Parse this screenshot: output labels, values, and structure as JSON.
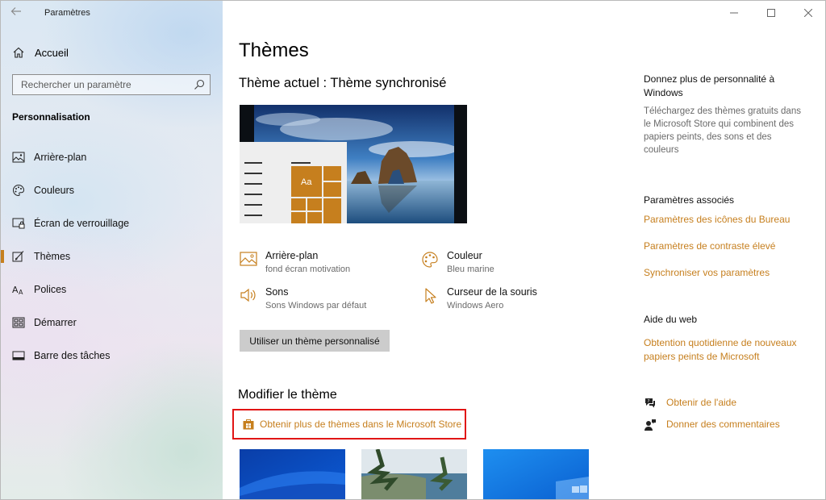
{
  "app": {
    "title": "Paramètres"
  },
  "sidebar": {
    "home_label": "Accueil",
    "search_placeholder": "Rechercher un paramètre",
    "section_title": "Personnalisation",
    "items": [
      {
        "label": "Arrière-plan",
        "icon": "picture-icon"
      },
      {
        "label": "Couleurs",
        "icon": "palette-icon"
      },
      {
        "label": "Écran de verrouillage",
        "icon": "lock-screen-icon"
      },
      {
        "label": "Thèmes",
        "icon": "brush-icon",
        "active": true
      },
      {
        "label": "Polices",
        "icon": "font-icon"
      },
      {
        "label": "Démarrer",
        "icon": "start-icon"
      },
      {
        "label": "Barre des tâches",
        "icon": "taskbar-icon"
      }
    ]
  },
  "main": {
    "title": "Thèmes",
    "current_theme": "Thème actuel : Thème synchronisé",
    "preview_tile_text": "Aa",
    "properties": {
      "background": {
        "title": "Arrière-plan",
        "value": "fond écran motivation"
      },
      "color": {
        "title": "Couleur",
        "value": "Bleu marine"
      },
      "sounds": {
        "title": "Sons",
        "value": "Sons Windows par défaut"
      },
      "cursor": {
        "title": "Curseur de la souris",
        "value": "Windows Aero"
      }
    },
    "custom_theme_button": "Utiliser un thème personnalisé",
    "modify_title": "Modifier le thème",
    "store_link": "Obtenir plus de thèmes dans le Microsoft Store"
  },
  "right": {
    "promo_title": "Donnez plus de personnalité à Windows",
    "promo_text": "Téléchargez des thèmes gratuits dans le Microsoft Store qui combinent des papiers peints, des sons et des couleurs",
    "related_title": "Paramètres associés",
    "related_links": [
      "Paramètres des icônes du Bureau",
      "Paramètres de contraste élevé",
      "Synchroniser vos paramètres"
    ],
    "web_help_title": "Aide du web",
    "web_help_link": "Obtention quotidienne de nouveaux papiers peints de Microsoft",
    "get_help": "Obtenir de l'aide",
    "feedback": "Donner des commentaires"
  },
  "colors": {
    "accent": "#c67f1e",
    "highlight_border": "#e11515"
  }
}
